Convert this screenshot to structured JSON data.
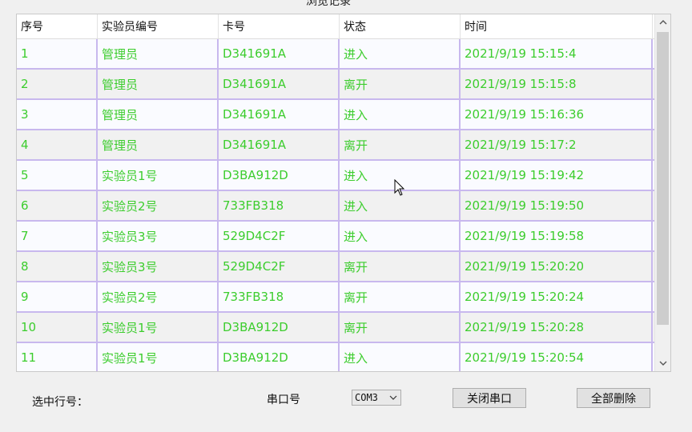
{
  "window": {
    "group_title": "浏览记录"
  },
  "table": {
    "headers": [
      "序号",
      "实验员编号",
      "卡号",
      "状态",
      "时间"
    ],
    "rows": [
      {
        "id": "1",
        "user": "管理员",
        "card": "D341691A",
        "status": "进入",
        "time": "2021/9/19 15:15:4"
      },
      {
        "id": "2",
        "user": "管理员",
        "card": "D341691A",
        "status": "离开",
        "time": "2021/9/19 15:15:8"
      },
      {
        "id": "3",
        "user": "管理员",
        "card": "D341691A",
        "status": "进入",
        "time": "2021/9/19 15:16:36"
      },
      {
        "id": "4",
        "user": "管理员",
        "card": "D341691A",
        "status": "离开",
        "time": "2021/9/19 15:17:2"
      },
      {
        "id": "5",
        "user": "实验员1号",
        "card": "D3BA912D",
        "status": "进入",
        "time": "2021/9/19 15:19:42"
      },
      {
        "id": "6",
        "user": "实验员2号",
        "card": "733FB318",
        "status": "进入",
        "time": "2021/9/19 15:19:50"
      },
      {
        "id": "7",
        "user": "实验员3号",
        "card": "529D4C2F",
        "status": "进入",
        "time": "2021/9/19 15:19:58"
      },
      {
        "id": "8",
        "user": "实验员3号",
        "card": "529D4C2F",
        "status": "离开",
        "time": "2021/9/19 15:20:20"
      },
      {
        "id": "9",
        "user": "实验员2号",
        "card": "733FB318",
        "status": "离开",
        "time": "2021/9/19 15:20:24"
      },
      {
        "id": "10",
        "user": "实验员1号",
        "card": "D3BA912D",
        "status": "离开",
        "time": "2021/9/19 15:20:28"
      },
      {
        "id": "11",
        "user": "实验员1号",
        "card": "D3BA912D",
        "status": "进入",
        "time": "2021/9/19 15:20:54"
      }
    ]
  },
  "footer": {
    "selected_row_label": "选中行号：",
    "port_label": "串口号",
    "port_value": "COM3",
    "close_port_button": "关闭串口",
    "delete_all_button": "全部删除"
  },
  "colors": {
    "row_text": "#3ccd2d",
    "grid_line": "#c8b8ee"
  },
  "icons": {
    "scroll_up": "chevron-up-icon",
    "scroll_down": "chevron-down-icon",
    "combo_arrow": "chevron-down-icon",
    "cursor": "mouse-pointer-icon"
  }
}
